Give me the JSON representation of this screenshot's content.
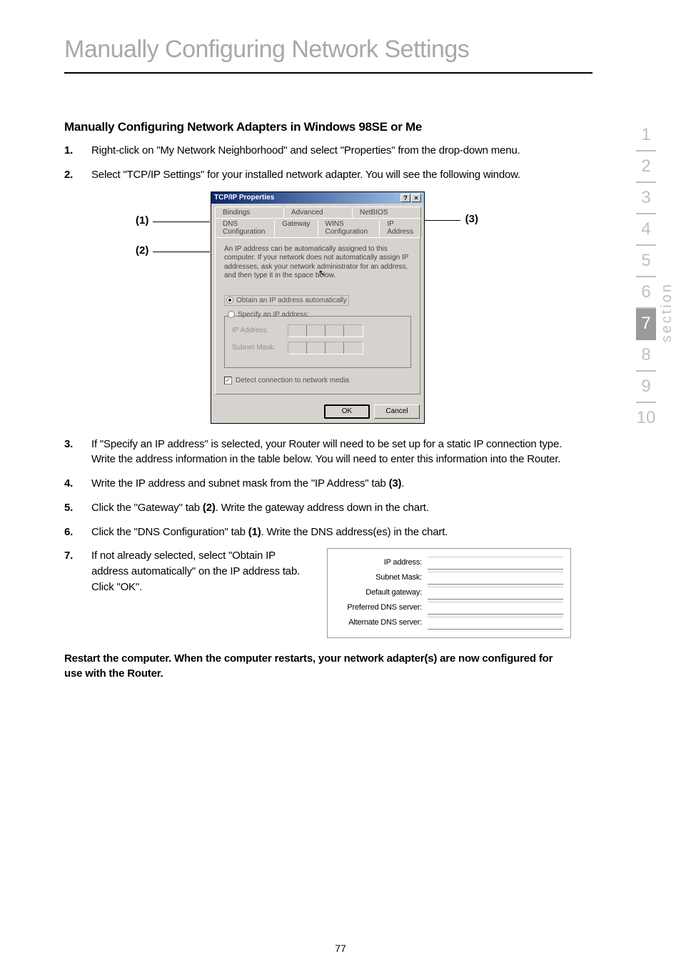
{
  "page_title": "Manually Configuring Network Settings",
  "section_heading": "Manually Configuring Network Adapters in Windows 98SE or Me",
  "steps": {
    "s1_num": "1.",
    "s1_text": "Right-click on \"My Network Neighborhood\" and select \"Properties\" from the drop-down menu.",
    "s2_num": "2.",
    "s2_text": "Select \"TCP/IP Settings\" for your installed network adapter. You will see the following window.",
    "s3_num": "3.",
    "s3_text": "If \"Specify an IP address\" is selected, your Router will need to be set up for a static IP connection type. Write the address information in the table below. You will need to enter this information into the Router.",
    "s4_num": "4.",
    "s4_text_a": "Write the IP address and subnet mask from the \"IP Address\" tab ",
    "s4_bold": "(3)",
    "s4_text_b": ".",
    "s5_num": "5.",
    "s5_text_a": "Click the \"Gateway\" tab ",
    "s5_bold": "(2)",
    "s5_text_b": ". Write the gateway address down in the chart.",
    "s6_num": "6.",
    "s6_text_a": "Click the \"DNS Configuration\" tab ",
    "s6_bold": "(1)",
    "s6_text_b": ". Write the DNS address(es) in the chart.",
    "s7_num": "7.",
    "s7_text": "If not already selected, select \"Obtain IP address automatically\" on the IP address tab. Click \"OK\"."
  },
  "dialog": {
    "title": "TCP/IP Properties",
    "tabs_top": {
      "bindings": "Bindings",
      "advanced": "Advanced",
      "netbios": "NetBIOS"
    },
    "tabs_bottom": {
      "dns": "DNS Configuration",
      "gateway": "Gateway",
      "wins": "WINS Configuration",
      "ip": "IP Address"
    },
    "info": "An IP address can be automatically assigned to this computer. If your network does not automatically assign IP addresses, ask your network administrator for an address, and then type it in the space below.",
    "radio_auto": "Obtain an IP address automatically",
    "radio_specify": "Specify an IP address:",
    "field_ip": "IP Address:",
    "field_subnet": "Subnet Mask:",
    "checkbox": "Detect connection to network media",
    "btn_ok": "OK",
    "btn_cancel": "Cancel"
  },
  "callouts": {
    "c1": "(1)",
    "c2": "(2)",
    "c3": "(3)"
  },
  "form": {
    "ip": "IP address:",
    "subnet": "Subnet Mask:",
    "gateway": "Default gateway:",
    "dns1": "Preferred DNS server:",
    "dns2": "Alternate DNS server:"
  },
  "closing": "Restart the computer. When the computer restarts, your network adapter(s) are now configured for use with the Router.",
  "page_number": "77",
  "nav": {
    "n1": "1",
    "n2": "2",
    "n3": "3",
    "n4": "4",
    "n5": "5",
    "n6": "6",
    "n7": "7",
    "n8": "8",
    "n9": "9",
    "n10": "10"
  },
  "section_label": "section"
}
